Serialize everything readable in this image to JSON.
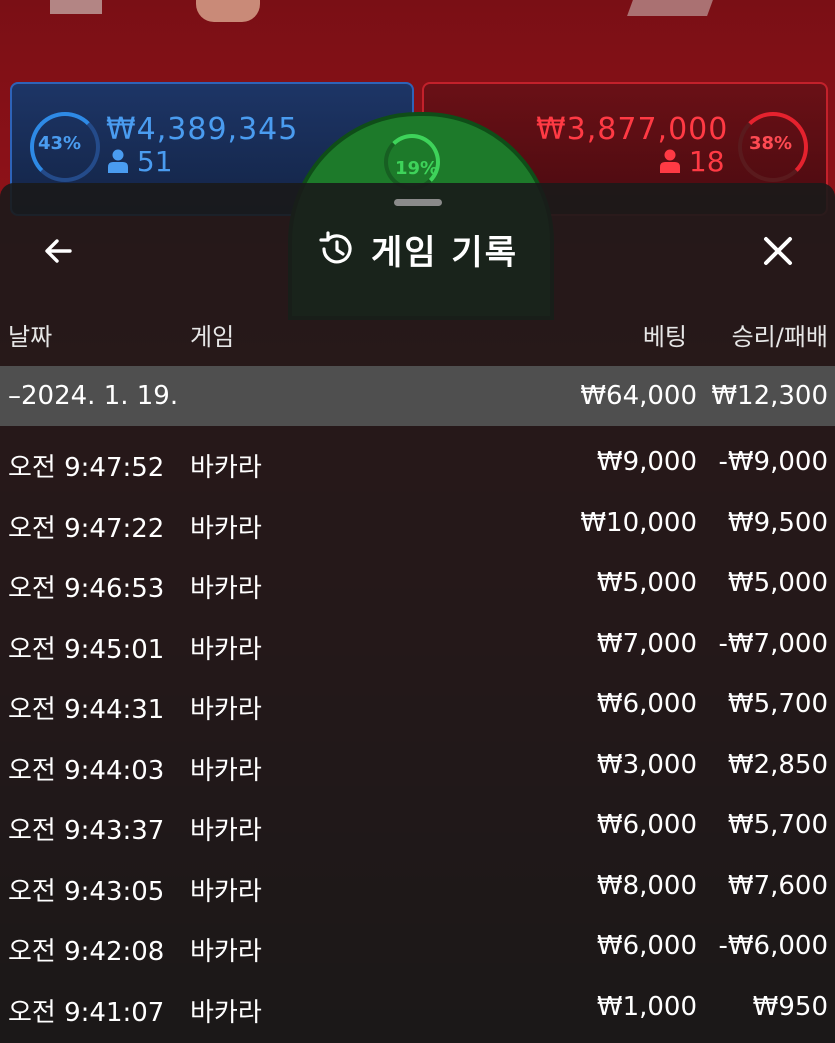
{
  "background": {
    "player_percent": "43%",
    "player_amount": "₩4,389,345",
    "player_count": "51",
    "banker_percent": "38%",
    "banker_amount": "₩3,877,000",
    "banker_count": "18",
    "tie_percent": "19%"
  },
  "header": {
    "title": "게임 기록",
    "back_icon": "arrow-left-icon",
    "history_icon": "history-clock-icon",
    "close_icon": "close-icon"
  },
  "columns": {
    "date": "날짜",
    "game": "게임",
    "bet": "베팅",
    "win_loss": "승리/패배"
  },
  "summary": {
    "date": "–2024. 1. 19.",
    "bet": "₩64,000",
    "win_loss": "₩12,300"
  },
  "rows": [
    {
      "time": "오전 9:47:52",
      "game": "바카라",
      "bet": "₩9,000",
      "result": "-₩9,000"
    },
    {
      "time": "오전 9:47:22",
      "game": "바카라",
      "bet": "₩10,000",
      "result": "₩9,500"
    },
    {
      "time": "오전 9:46:53",
      "game": "바카라",
      "bet": "₩5,000",
      "result": "₩5,000"
    },
    {
      "time": "오전 9:45:01",
      "game": "바카라",
      "bet": "₩7,000",
      "result": "-₩7,000"
    },
    {
      "time": "오전 9:44:31",
      "game": "바카라",
      "bet": "₩6,000",
      "result": "₩5,700"
    },
    {
      "time": "오전 9:44:03",
      "game": "바카라",
      "bet": "₩3,000",
      "result": "₩2,850"
    },
    {
      "time": "오전 9:43:37",
      "game": "바카라",
      "bet": "₩6,000",
      "result": "₩5,700"
    },
    {
      "time": "오전 9:43:05",
      "game": "바카라",
      "bet": "₩8,000",
      "result": "₩7,600"
    },
    {
      "time": "오전 9:42:08",
      "game": "바카라",
      "bet": "₩6,000",
      "result": "-₩6,000"
    },
    {
      "time": "오전 9:41:07",
      "game": "바카라",
      "bet": "₩1,000",
      "result": "₩950"
    }
  ],
  "colors": {
    "player_blue": "#4a9cf0",
    "banker_red": "#ff3a44",
    "tie_green": "#3ed35a",
    "summary_bg": "#4f4f4f"
  }
}
